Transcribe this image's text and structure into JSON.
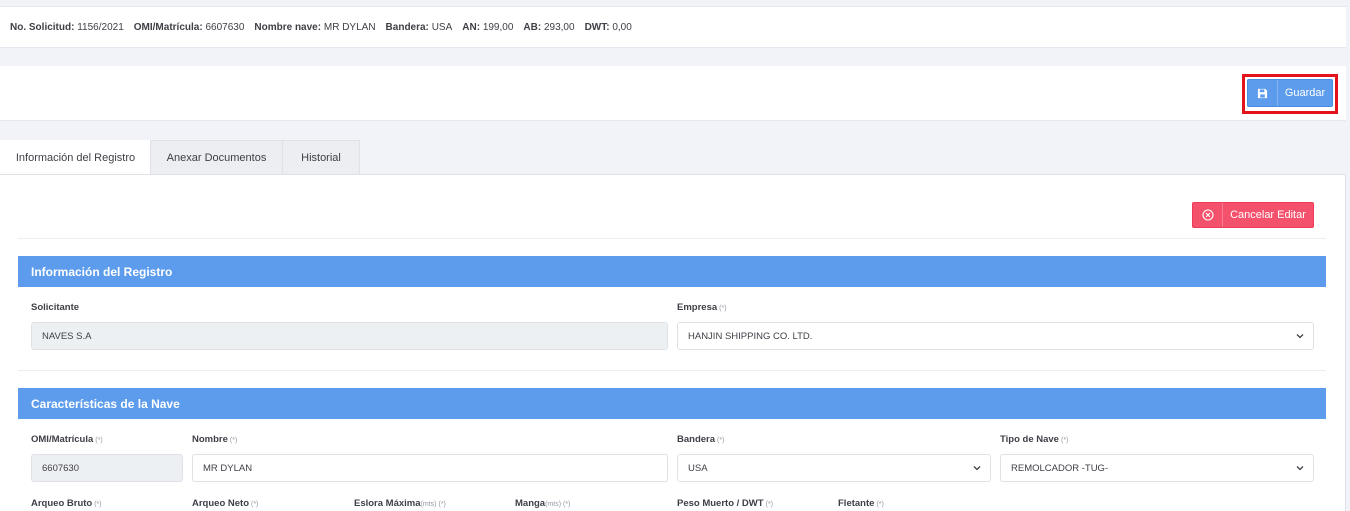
{
  "summary": {
    "solicitud_label": "No. Solicitud:",
    "solicitud_value": "1156/2021",
    "omi_label": "OMI/Matrícula:",
    "omi_value": "6607630",
    "nave_label": "Nombre nave:",
    "nave_value": "MR DYLAN",
    "bandera_label": "Bandera:",
    "bandera_value": "USA",
    "an_label": "AN:",
    "an_value": "199,00",
    "ab_label": "AB:",
    "ab_value": "293,00",
    "dwt_label": "DWT:",
    "dwt_value": "0,00"
  },
  "toolbar": {
    "save_label": "Guardar"
  },
  "tabs": [
    {
      "label": "Información del Registro"
    },
    {
      "label": "Anexar Documentos"
    },
    {
      "label": "Historial"
    }
  ],
  "actions": {
    "cancel_label": "Cancelar Editar"
  },
  "section_registro": {
    "title": "Información del Registro",
    "solicitante_label": "Solicitante",
    "solicitante_value": "NAVES S.A",
    "empresa_label": "Empresa",
    "empresa_value": "HANJIN SHIPPING CO. LTD."
  },
  "section_nave": {
    "title": "Características de la Nave",
    "omi_label": "OMI/Matrícula",
    "omi_value": "6607630",
    "nombre_label": "Nombre",
    "nombre_value": "MR DYLAN",
    "bandera_label": "Bandera",
    "bandera_value": "USA",
    "tipo_label": "Tipo de Nave",
    "tipo_value": "REMOLCADOR -TUG-",
    "arqueo_bruto_label": "Arqueo Bruto",
    "arqueo_neto_label": "Arqueo Neto",
    "eslora_label": "Eslora Máxima",
    "eslora_unit": "(mts)",
    "manga_label": "Manga",
    "manga_unit": "(mts)",
    "peso_label": "Peso Muerto / DWT",
    "fletante_label": "Fletante"
  },
  "required_mark": "(*)",
  "colors": {
    "primary": "#5d9cec",
    "danger": "#f4516c",
    "highlight": "#e3121b"
  }
}
